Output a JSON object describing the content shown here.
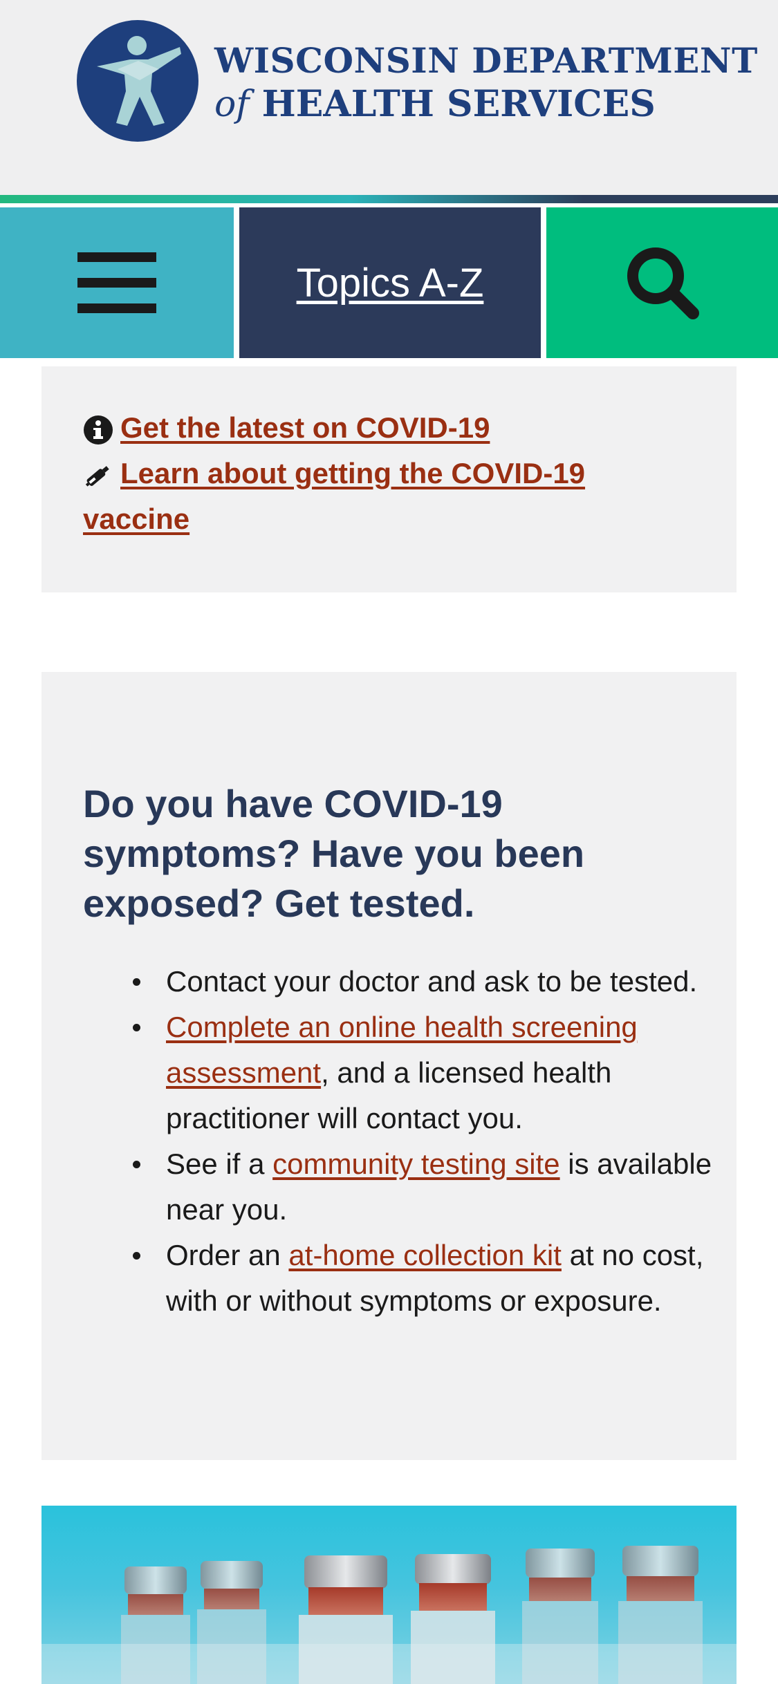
{
  "header": {
    "logo_line1": "WISCONSIN DEPARTMENT",
    "logo_line2_of": "of",
    "logo_line2_rest": " HEALTH SERVICES",
    "logo_icon": "person-figure-emblem-icon"
  },
  "nav": {
    "menu_icon": "hamburger-menu-icon",
    "topics_label": "Topics A-Z",
    "search_icon": "search-icon",
    "colors": {
      "menu": "#3fb3c4",
      "topics": "#2c3a5a",
      "search": "#00bd7e"
    }
  },
  "alerts": {
    "items": [
      {
        "icon": "info-circle-icon",
        "label": "Get the latest on COVID-19"
      },
      {
        "icon": "syringe-icon",
        "label": "Learn about getting the COVID-19 vaccine"
      }
    ]
  },
  "covid_section": {
    "title": "Do you have COVID-19 symptoms? Have you been exposed? Get tested.",
    "items": [
      {
        "text": "Contact your doctor and ask to be tested."
      },
      {
        "link": "Complete an online health screening assessment",
        "after": ", and a licensed health practitioner will contact you."
      },
      {
        "before": "See if a ",
        "link": "community testing site",
        "after": " is available near you."
      },
      {
        "before": "Order an ",
        "link": "at-home collection kit",
        "after": " at no cost, with or without symptoms or exposure."
      }
    ]
  },
  "hero_image": {
    "subject": "vaccine-vials-image"
  },
  "colors": {
    "link": "#9a2f12",
    "heading": "#283858",
    "panel": "#f1f1f2"
  }
}
